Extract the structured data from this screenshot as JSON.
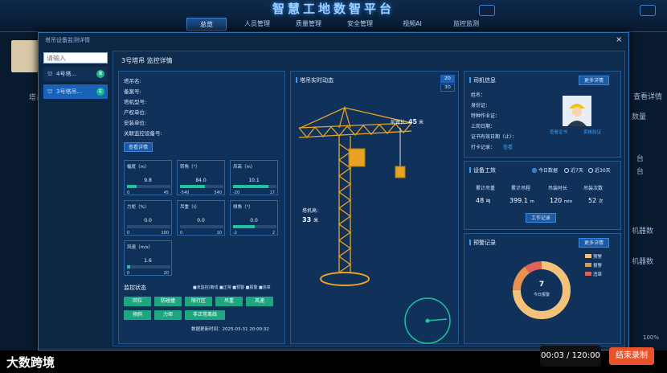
{
  "app": {
    "title": "智慧工地数智平台",
    "nav": [
      "总览",
      "人员管理",
      "质量管理",
      "安全管理",
      "视频AI",
      "监控监测"
    ],
    "active_nav": 0
  },
  "background": {
    "left_label": "塔吊",
    "right_labels": [
      "查看详情",
      "数量",
      "台",
      "台",
      "机器数",
      "机器数"
    ],
    "zoom": "100%"
  },
  "recording": {
    "logo": "大数跨境",
    "time": "00:03 / 120:00",
    "stop_label": "结束录制"
  },
  "modal": {
    "title": "塔吊设备监测详情",
    "close": "×",
    "search_placeholder": "请输入",
    "devices": [
      {
        "name": "4号塔...",
        "badge": "离",
        "selected": false
      },
      {
        "name": "3号塔吊...",
        "badge": "在",
        "selected": true
      }
    ],
    "detail_title": "3号塔吊 监控详情",
    "info": {
      "fields": [
        "塔吊名:",
        "备案号:",
        "塔机型号:",
        "产权单位:",
        "安装单位:",
        "关联监控设备号:"
      ],
      "button": "查看详情"
    },
    "gauges": [
      {
        "title": "幅度（m）",
        "value": "9.8",
        "min": "0",
        "max": "45",
        "level": 0.22
      },
      {
        "title": "转角（°）",
        "value": "84.0",
        "min": "-540",
        "max": "540",
        "level": 0.58
      },
      {
        "title": "吊高（m）",
        "value": "10.1",
        "min": "-20",
        "max": "17",
        "level": 0.82
      },
      {
        "title": "力矩（%）",
        "value": "0.0",
        "min": "0",
        "max": "100",
        "level": 0
      },
      {
        "title": "吊重（t）",
        "value": "0.0",
        "min": "0",
        "max": "10",
        "level": 0
      },
      {
        "title": "倾角（°）",
        "value": "0.0",
        "min": "-2",
        "max": "2",
        "level": 0.5
      },
      {
        "title": "风速（m/s）",
        "value": "1.6",
        "min": "0",
        "max": "20",
        "level": 0.08
      }
    ],
    "status": {
      "title": "监控状态",
      "legend": "■未监控/离线 ■正常 ■预警 ■报警 ■违章",
      "buttons": [
        "回位",
        "防碰撞",
        "限行区",
        "吊重",
        "风速",
        "倾斜",
        "力矩",
        "非正常离线"
      ],
      "time_label": "数据更新时间：",
      "time": "2025-03-31 20:00:32"
    },
    "realtime": {
      "title": "塔吊实时动态",
      "toggles": [
        "2D",
        "3D"
      ],
      "front_arm": "前臂长:",
      "front_arm_value": "45",
      "front_arm_unit": "米",
      "tower_height": "塔机高:",
      "tower_height_value": "33",
      "tower_height_unit": "米"
    },
    "driver": {
      "title": "司机信息",
      "button": "更多详情",
      "fields": [
        "姓名：",
        "身份证：",
        "特种作业证：",
        "上岗日期：",
        "证书有效日期（止）：",
        "打卡记录："
      ],
      "punch_link": "查看",
      "photo_link": "查看证书",
      "photo_link2": "资格验证"
    },
    "work": {
      "title": "设备工效",
      "range": [
        "今日数据",
        "近7天",
        "近30天"
      ],
      "range_selected": 0,
      "headers": [
        "累计吊重",
        "累计吊程",
        "吊装时长",
        "吊装次数"
      ],
      "values": [
        "48",
        "399.1",
        "120",
        "52"
      ],
      "units": [
        "吨",
        "m",
        "min",
        "次"
      ],
      "button": "工作记录"
    },
    "records": {
      "title": "预警记录",
      "button": "更多详情",
      "total": "7",
      "total_label": "今日报警",
      "legend": [
        "预警",
        "报警",
        "违章"
      ],
      "legend_colors": [
        "#f2c27a",
        "#e9924b",
        "#e0605a"
      ],
      "parts": [
        0.75,
        0.15,
        0.1
      ]
    }
  }
}
